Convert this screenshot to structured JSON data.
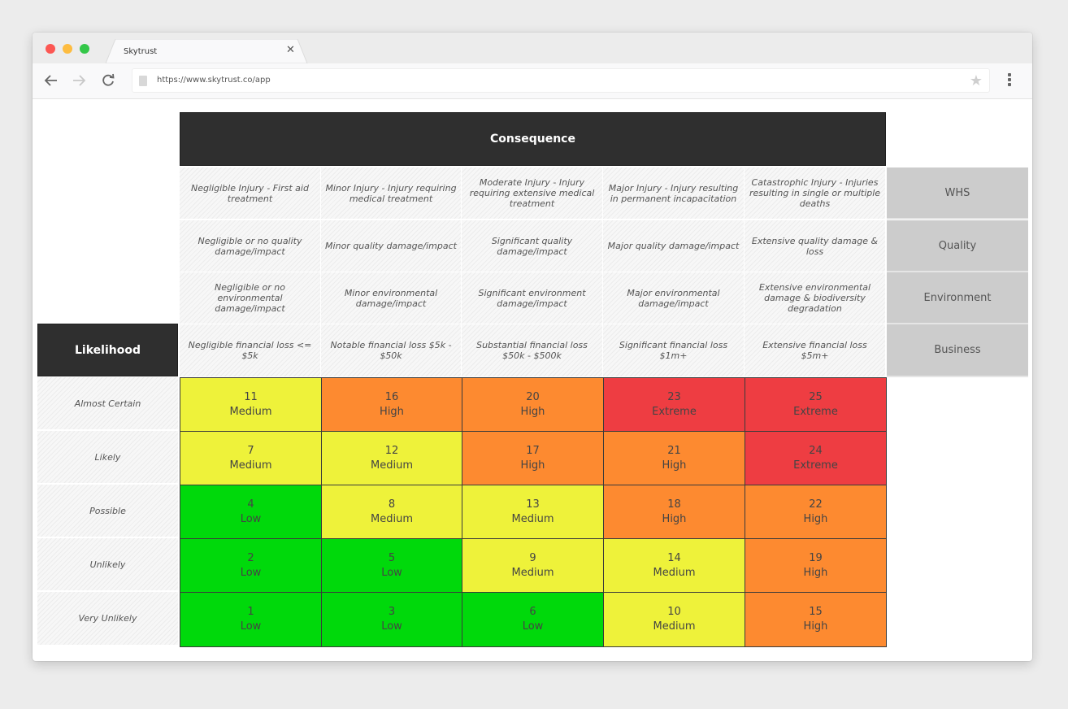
{
  "browser": {
    "tab_title": "Skytrust",
    "url": "https://www.skytrust.co/app",
    "icons": {
      "back": "arrow-left",
      "forward": "arrow-right",
      "reload": "reload",
      "page": "document",
      "bookmark": "star",
      "menu": "three-dots-vertical",
      "close_tab": "x"
    }
  },
  "matrix": {
    "consequence_title": "Consequence",
    "likelihood_title": "Likelihood",
    "categories": [
      "WHS",
      "Quality",
      "Environment",
      "Business"
    ],
    "descriptors": [
      [
        "Negligible Injury - First aid treatment",
        "Minor Injury - Injury requiring medical treatment",
        "Moderate Injury - Injury requiring extensive medical treatment",
        "Major Injury - Injury resulting in permanent incapacitation",
        "Catastrophic Injury - Injuries resulting in single or multiple deaths"
      ],
      [
        "Negligible or no quality damage/impact",
        "Minor quality damage/impact",
        "Significant quality damage/impact",
        "Major quality damage/impact",
        "Extensive quality damage & loss"
      ],
      [
        "Negligible or no environmental damage/impact",
        "Minor environmental damage/impact",
        "Significant environment damage/impact",
        "Major environmental damage/impact",
        "Extensive environmental damage & biodiversity degradation"
      ],
      [
        "Negligible financial loss <= $5k",
        "Notable financial loss $5k - $50k",
        "Substantial financial loss $50k - $500k",
        "Significant financial loss $1m+",
        "Extensive financial loss $5m+"
      ]
    ],
    "likelihoods": [
      "Almost Certain",
      "Likely",
      "Possible",
      "Unlikely",
      "Very Unlikely"
    ],
    "level_colors": {
      "Low": "#00d90b",
      "Medium": "#eef23a",
      "High": "#fd8a30",
      "Extreme": "#ee3d42"
    },
    "cells": [
      [
        {
          "score": "11",
          "level": "Medium"
        },
        {
          "score": "16",
          "level": "High"
        },
        {
          "score": "20",
          "level": "High"
        },
        {
          "score": "23",
          "level": "Extreme"
        },
        {
          "score": "25",
          "level": "Extreme"
        }
      ],
      [
        {
          "score": "7",
          "level": "Medium"
        },
        {
          "score": "12",
          "level": "Medium"
        },
        {
          "score": "17",
          "level": "High"
        },
        {
          "score": "21",
          "level": "High"
        },
        {
          "score": "24",
          "level": "Extreme"
        }
      ],
      [
        {
          "score": "4",
          "level": "Low"
        },
        {
          "score": "8",
          "level": "Medium"
        },
        {
          "score": "13",
          "level": "Medium"
        },
        {
          "score": "18",
          "level": "High"
        },
        {
          "score": "22",
          "level": "High"
        }
      ],
      [
        {
          "score": "2",
          "level": "Low"
        },
        {
          "score": "5",
          "level": "Low"
        },
        {
          "score": "9",
          "level": "Medium"
        },
        {
          "score": "14",
          "level": "Medium"
        },
        {
          "score": "19",
          "level": "High"
        }
      ],
      [
        {
          "score": "1",
          "level": "Low"
        },
        {
          "score": "3",
          "level": "Low"
        },
        {
          "score": "6",
          "level": "Low"
        },
        {
          "score": "10",
          "level": "Medium"
        },
        {
          "score": "15",
          "level": "High"
        }
      ]
    ]
  }
}
